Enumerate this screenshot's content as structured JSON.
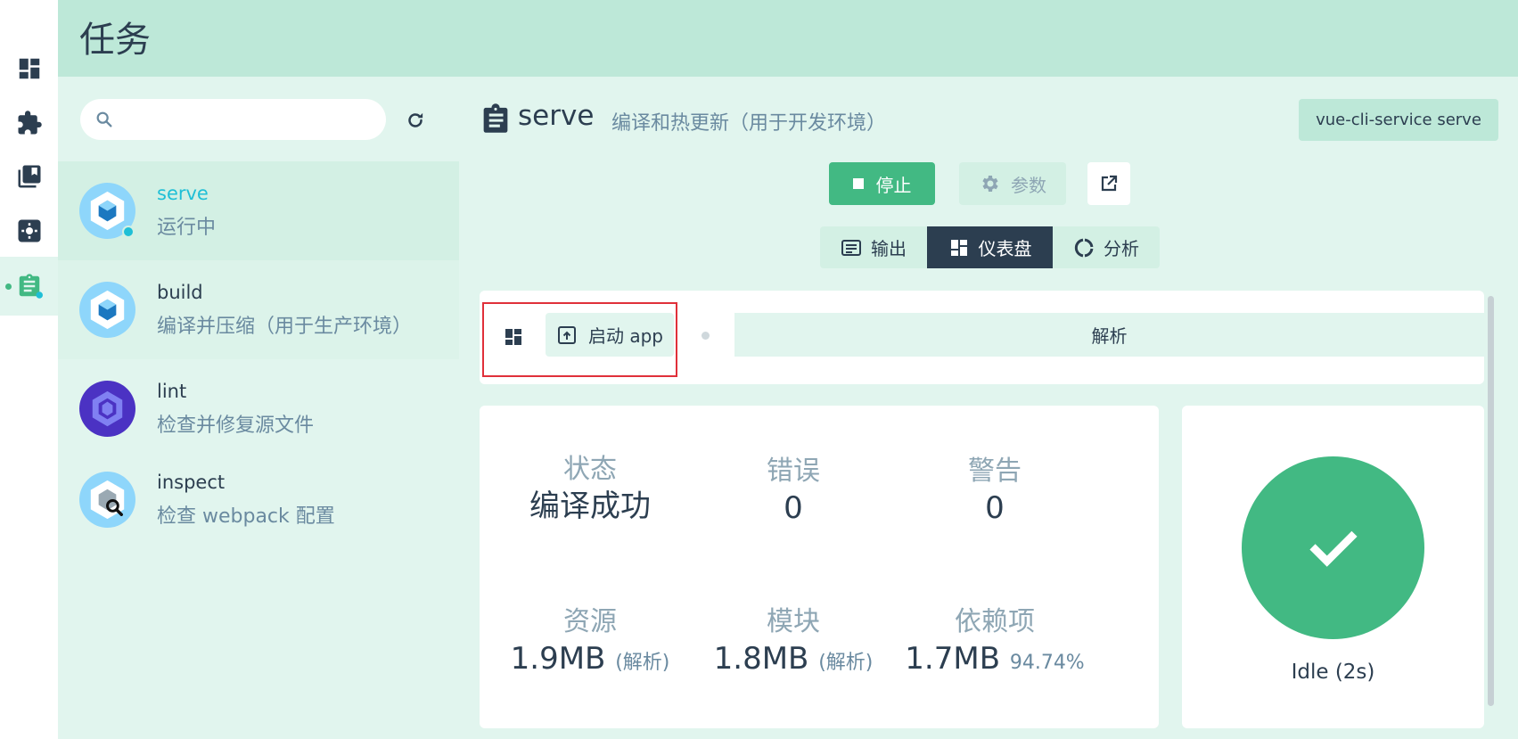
{
  "page": {
    "title": "任务"
  },
  "rail": {
    "items": [
      {
        "name": "dashboard",
        "icon": "dashboard-icon"
      },
      {
        "name": "plugins",
        "icon": "puzzle-icon"
      },
      {
        "name": "dependencies",
        "icon": "library-icon"
      },
      {
        "name": "configuration",
        "icon": "gear-icon"
      },
      {
        "name": "tasks",
        "icon": "clipboard-icon",
        "active": true
      }
    ]
  },
  "search": {
    "value": "",
    "placeholder": ""
  },
  "tasks": [
    {
      "name": "serve",
      "desc": "运行中",
      "status": "running"
    },
    {
      "name": "build",
      "desc": "编译并压缩（用于生产环境）"
    },
    {
      "name": "lint",
      "desc": "检查并修复源文件"
    },
    {
      "name": "inspect",
      "desc": "检查 webpack 配置"
    }
  ],
  "task_detail": {
    "name": "serve",
    "desc": "编译和热更新（用于开发环境）",
    "command": "vue-cli-service serve",
    "stop_label": "停止",
    "params_label": "参数"
  },
  "tabs": [
    {
      "label": "输出"
    },
    {
      "label": "仪表盘",
      "active": true
    },
    {
      "label": "分析"
    }
  ],
  "steps": {
    "start_label": "启动 app",
    "parse_label": "解析"
  },
  "stats": {
    "status": {
      "label": "状态",
      "value": "编译成功"
    },
    "errors": {
      "label": "错误",
      "value": "0"
    },
    "warnings": {
      "label": "警告",
      "value": "0"
    },
    "assets": {
      "label": "资源",
      "value": "1.9MB",
      "note": "(解析)"
    },
    "modules": {
      "label": "模块",
      "value": "1.8MB",
      "note": "(解析)"
    },
    "deps": {
      "label": "依赖项",
      "value": "1.7MB",
      "note": "94.74%"
    }
  },
  "status_circle": {
    "text": "Idle (2s)"
  },
  "colors": {
    "accent": "#42b983",
    "dark": "#2c3e50",
    "running": "#1fbfd6",
    "highlight": "#e0303a"
  }
}
